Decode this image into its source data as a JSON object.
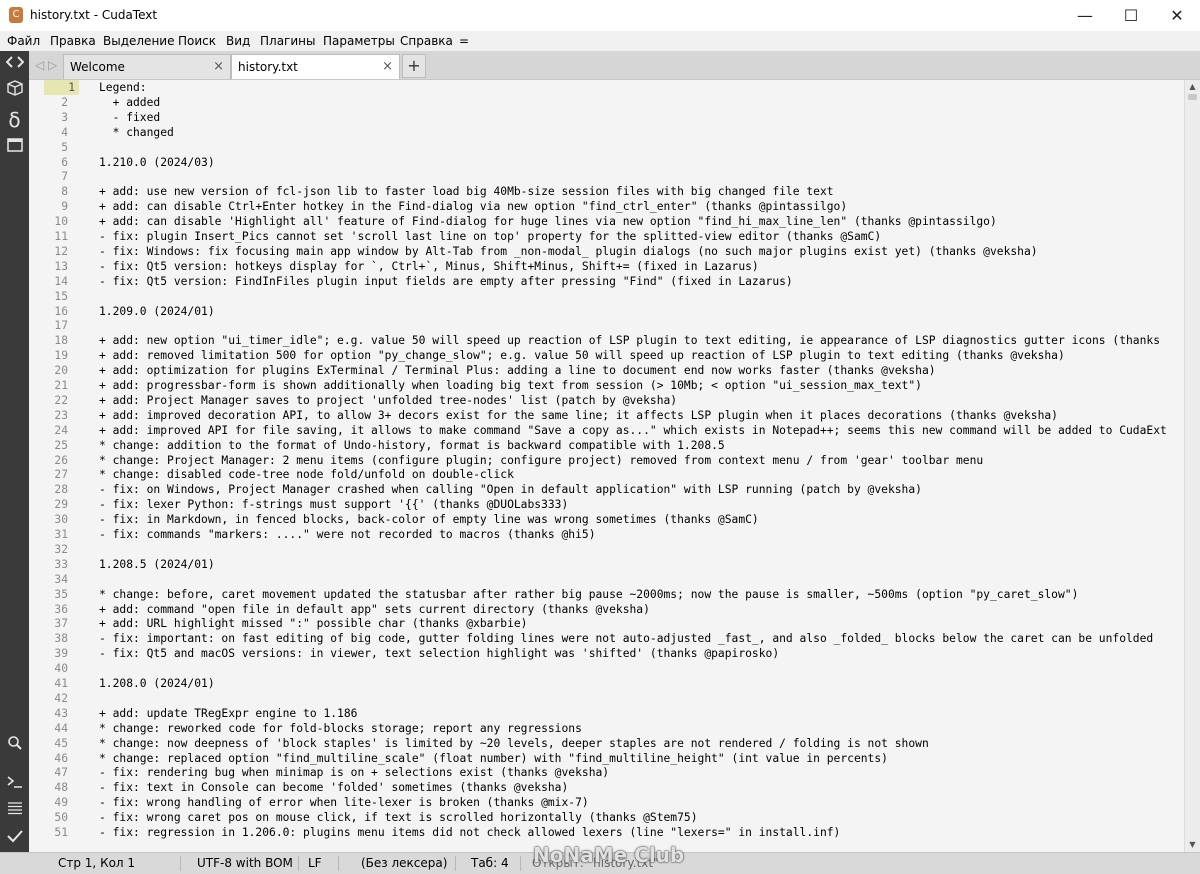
{
  "window": {
    "title": "history.txt - CudaText",
    "minimize": "—",
    "maximize": "☐",
    "close": "✕"
  },
  "menu": [
    "Файл",
    "Правка",
    "Выделение",
    "Поиск",
    "Вид",
    "Плагины",
    "Параметры",
    "Справка",
    "="
  ],
  "tabs": [
    {
      "label": "Welcome",
      "close": "×",
      "active": false
    },
    {
      "label": "history.txt",
      "close": "×",
      "active": true
    }
  ],
  "tab_nav": "◁ ▷",
  "tab_add": "+",
  "editor": {
    "current_line": 1,
    "lines": [
      "Legend:",
      "  + added",
      "  - fixed",
      "  * changed",
      "",
      "1.210.0 (2024/03)",
      "",
      "+ add: use new version of fcl-json lib to faster load big 40Mb-size session files with big changed file text",
      "+ add: can disable Ctrl+Enter hotkey in the Find-dialog via new option \"find_ctrl_enter\" (thanks @pintassilgo)",
      "+ add: can disable 'Highlight all' feature of Find-dialog for huge lines via new option \"find_hi_max_line_len\" (thanks @pintassilgo)",
      "- fix: plugin Insert_Pics cannot set 'scroll last line on top' property for the splitted-view editor (thanks @SamC)",
      "- fix: Windows: fix focusing main app window by Alt-Tab from _non-modal_ plugin dialogs (no such major plugins exist yet) (thanks @veksha)",
      "- fix: Qt5 version: hotkeys display for `, Ctrl+`, Minus, Shift+Minus, Shift+= (fixed in Lazarus)",
      "- fix: Qt5 version: FindInFiles plugin input fields are empty after pressing \"Find\" (fixed in Lazarus)",
      "",
      "1.209.0 (2024/01)",
      "",
      "+ add: new option \"ui_timer_idle\"; e.g. value 50 will speed up reaction of LSP plugin to text editing, ie appearance of LSP diagnostics gutter icons (thanks",
      "+ add: removed limitation 500 for option \"py_change_slow\"; e.g. value 50 will speed up reaction of LSP plugin to text editing (thanks @veksha)",
      "+ add: optimization for plugins ExTerminal / Terminal Plus: adding a line to document end now works faster (thanks @veksha)",
      "+ add: progressbar-form is shown additionally when loading big text from session (> 10Mb; < option \"ui_session_max_text\")",
      "+ add: Project Manager saves to project 'unfolded tree-nodes' list (patch by @veksha)",
      "+ add: improved decoration API, to allow 3+ decors exist for the same line; it affects LSP plugin when it places decorations (thanks @veksha)",
      "+ add: improved API for file saving, it allows to make command \"Save a copy as...\" which exists in Notepad++; seems this new command will be added to CudaExt",
      "* change: addition to the format of Undo-history, format is backward compatible with 1.208.5",
      "* change: Project Manager: 2 menu items (configure plugin; configure project) removed from context menu / from 'gear' toolbar menu",
      "* change: disabled code-tree node fold/unfold on double-click",
      "- fix: on Windows, Project Manager crashed when calling \"Open in default application\" with LSP running (patch by @veksha)",
      "- fix: lexer Python: f-strings must support '{{' (thanks @DUOLabs333)",
      "- fix: in Markdown, in fenced blocks, back-color of empty line was wrong sometimes (thanks @SamC)",
      "- fix: commands \"markers: ....\" were not recorded to macros (thanks @hi5)",
      "",
      "1.208.5 (2024/01)",
      "",
      "* change: before, caret movement updated the statusbar after rather big pause ~2000ms; now the pause is smaller, ~500ms (option \"py_caret_slow\")",
      "+ add: command \"open file in default app\" sets current directory (thanks @veksha)",
      "+ add: URL highlight missed \":\" possible char (thanks @xbarbie)",
      "- fix: important: on fast editing of big code, gutter folding lines were not auto-adjusted _fast_, and also _folded_ blocks below the caret can be unfolded",
      "- fix: Qt5 and macOS versions: in viewer, text selection highlight was 'shifted' (thanks @papirosko)",
      "",
      "1.208.0 (2024/01)",
      "",
      "+ add: update TRegExpr engine to 1.186",
      "* change: reworked code for fold-blocks storage; report any regressions",
      "* change: now deepness of 'block staples' is limited by ~20 levels, deeper staples are not rendered / folding is not shown",
      "* change: replaced option \"find_multiline_scale\" (float number) with \"find_multiline_height\" (int value in percents)",
      "- fix: rendering bug when minimap is on + selections exist (thanks @veksha)",
      "- fix: text in Console can become 'folded' sometimes (thanks @veksha)",
      "- fix: wrong handling of error when lite-lexer is broken (thanks @mix-7)",
      "- fix: wrong caret pos on mouse click, if text is scrolled horizontally (thanks @Stem75)",
      "- fix: regression in 1.206.0: plugins menu items did not check allowed lexers (line \"lexers=\" in install.inf)"
    ]
  },
  "statusbar": {
    "position": "Стр 1, Кол 1",
    "encoding": "UTF-8 with BOM",
    "line_ending": "LF",
    "lexer": "(Без лексера)",
    "tab_size": "Таб: 4",
    "message": "Открыт: \"history.txt\""
  },
  "watermark": "NoNaMe Club",
  "colors": {
    "sidebar": "#3a3a3a",
    "current_line_number": "#e6e6b0",
    "editor_bg": "#f4f4f4"
  }
}
